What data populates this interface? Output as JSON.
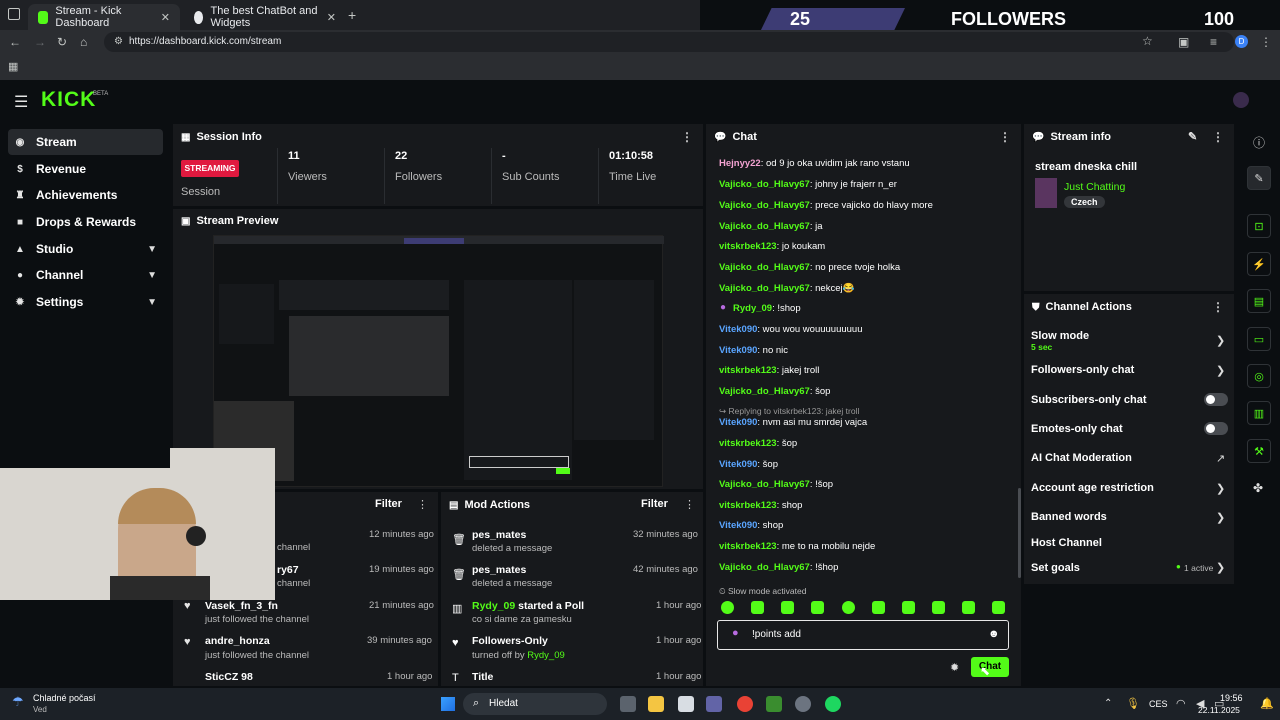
{
  "browser": {
    "tabs": [
      {
        "label": "Stream - Kick Dashboard",
        "active": true
      },
      {
        "label": "The best ChatBot and Widgets",
        "active": false
      }
    ],
    "url": "https://dashboard.kick.com/stream"
  },
  "overlay": {
    "count": "25",
    "label": "FOLLOWERS",
    "goal": "100",
    "viewers": "11"
  },
  "kick": {
    "logo": "KICK",
    "beta": "BETA"
  },
  "sidebar": {
    "items": [
      {
        "label": "Stream",
        "icon": "dot-icon",
        "active": true
      },
      {
        "label": "Revenue",
        "icon": "dollar-icon"
      },
      {
        "label": "Achievements",
        "icon": "trophy-icon"
      },
      {
        "label": "Drops & Rewards",
        "icon": "gift-icon"
      },
      {
        "label": "Studio",
        "icon": "studio-icon",
        "chevron": true
      },
      {
        "label": "Channel",
        "icon": "user-icon",
        "chevron": true
      },
      {
        "label": "Settings",
        "icon": "gear-icon",
        "chevron": true
      }
    ]
  },
  "session": {
    "title": "Session Info",
    "badge": "STREAMING",
    "session_label": "Session",
    "stats": [
      {
        "value": "11",
        "label": "Viewers"
      },
      {
        "value": "22",
        "label": "Followers"
      },
      {
        "value": "-",
        "label": "Sub Counts"
      },
      {
        "value": "01:10:58",
        "label": "Time Live"
      }
    ]
  },
  "preview": {
    "title": "Stream Preview"
  },
  "activity": {
    "filter": "Filter",
    "items": [
      {
        "name": "",
        "sub": "channel",
        "time": "12 minutes ago"
      },
      {
        "name": "ry67",
        "sub": "channel",
        "time": "19 minutes ago"
      },
      {
        "name": "Vasek_fn_3_fn",
        "sub": "just followed the channel",
        "time": "21 minutes ago"
      },
      {
        "name": "andre_honza",
        "sub": "just followed the channel",
        "time": "39 minutes ago"
      },
      {
        "name": "SticCZ 98",
        "sub": "",
        "time": "1 hour ago"
      }
    ]
  },
  "mod": {
    "title": "Mod Actions",
    "filter": "Filter",
    "items": [
      {
        "name": "pes_mates",
        "sub": "deleted a message",
        "time": "32 minutes ago"
      },
      {
        "name": "pes_mates",
        "sub": "deleted a message",
        "time": "42 minutes ago"
      },
      {
        "name": "Rydy_09",
        "name_suffix": "started a Poll",
        "sub": "co si dame za gamesku",
        "time": "1 hour ago"
      },
      {
        "name": "Followers-Only",
        "sub": "turned off by",
        "sub_user": "Rydy_09",
        "time": "1 hour ago"
      },
      {
        "name": "Title",
        "sub": "",
        "time": "1 hour ago"
      }
    ]
  },
  "chat": {
    "title": "Chat",
    "messages": [
      {
        "user": "Hejnyy22",
        "text": ": od 9 jo oka uvidim jak rano vstanu",
        "color": "#f4a3d2"
      },
      {
        "user": "Vajicko_do_Hlavy67",
        "text": ": johny je frajerr n_er",
        "color": "#53fc18"
      },
      {
        "user": "Vajicko_do_Hlavy67",
        "text": ": prece vajicko do hlavy more",
        "color": "#53fc18"
      },
      {
        "user": "Vajicko_do_Hlavy67",
        "text": ": ja",
        "color": "#53fc18"
      },
      {
        "user": "vitskrbek123",
        "text": ": jo koukam",
        "color": "#53fc18"
      },
      {
        "user": "Vajicko_do_Hlavy67",
        "text": ": no prece tvoje holka",
        "color": "#53fc18"
      },
      {
        "user": "Vajicko_do_Hlavy67",
        "text": ": nekcej😂",
        "color": "#53fc18"
      },
      {
        "user": "Rydy_09",
        "text": ": !shop",
        "color": "#53fc18"
      },
      {
        "user": "Vitek090",
        "text": ": wou wou wouuuuuuuuu",
        "color": "#5aa5ff"
      },
      {
        "user": "Vitek090",
        "text": ": no nic",
        "color": "#5aa5ff"
      },
      {
        "user": "vitskrbek123",
        "text": ": jakej troll",
        "color": "#53fc18"
      },
      {
        "user": "Vajicko_do_Hlavy67",
        "text": ": šop",
        "color": "#53fc18"
      },
      {
        "user": "Vitek090",
        "text": ": nvm asi mu smrdej vajca",
        "color": "#5aa5ff"
      },
      {
        "user": "vitskrbek123",
        "text": ": šop",
        "color": "#53fc18"
      },
      {
        "user": "Vitek090",
        "text": ": šop",
        "color": "#5aa5ff"
      },
      {
        "user": "Vajicko_do_Hlavy67",
        "text": ": !šop",
        "color": "#53fc18"
      },
      {
        "user": "vitskrbek123",
        "text": ": shop",
        "color": "#53fc18"
      },
      {
        "user": "Vitek090",
        "text": ": shop",
        "color": "#5aa5ff"
      },
      {
        "user": "vitskrbek123",
        "text": ": me to na mobilu nejde",
        "color": "#53fc18"
      },
      {
        "user": "Vajicko_do_Hlavy67",
        "text": ": !šhop",
        "color": "#53fc18"
      }
    ],
    "reply_hint": "Replying to vitskrbek123: jakej troll",
    "slow_mode_note": "Slow mode activated",
    "input_value": "!points add",
    "send_label": "Chat"
  },
  "stream_info": {
    "title": "Stream info",
    "stream_title": "stream dneska chill",
    "category": "Just Chatting",
    "language": "Czech"
  },
  "channel_actions": {
    "title": "Channel Actions",
    "items": [
      {
        "label": "Slow mode",
        "sub": "5 sec",
        "control": "chevron"
      },
      {
        "label": "Followers-only chat",
        "control": "chevron"
      },
      {
        "label": "Subscribers-only chat",
        "control": "toggle"
      },
      {
        "label": "Emotes-only chat",
        "control": "toggle"
      },
      {
        "label": "AI Chat Moderation",
        "control": "external"
      },
      {
        "label": "Account age restriction",
        "control": "chevron"
      },
      {
        "label": "Banned words",
        "control": "chevron"
      },
      {
        "label": "Host Channel",
        "control": "none"
      },
      {
        "label": "Set goals",
        "status": "1 active",
        "control": "chevron"
      }
    ]
  },
  "taskbar": {
    "weather_title": "Chladné počasí",
    "weather_sub": "Ved",
    "search": "Hledat",
    "lang": "CES",
    "time": "19:56",
    "date": "22.11.2025"
  },
  "colors": {
    "accent": "#53fc18",
    "panel": "#17191c",
    "bg": "#0b0e11",
    "streaming": "#e0193f"
  }
}
